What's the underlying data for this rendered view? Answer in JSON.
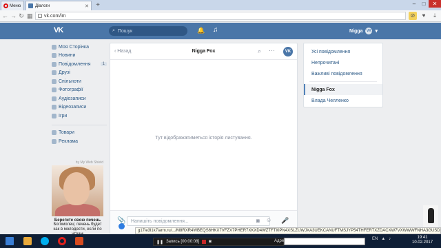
{
  "browser": {
    "menu_label": "Меню",
    "tab_title": "Діалоги",
    "url": "vk.com/im"
  },
  "vk_header": {
    "logo": "VK",
    "search_placeholder": "Пошук",
    "user_name": "Nigga",
    "avatar_text": "VK"
  },
  "left_nav": {
    "items": [
      {
        "label": "Моя Сторінка"
      },
      {
        "label": "Новини"
      },
      {
        "label": "Повідомлення",
        "badge": "1"
      },
      {
        "label": "Друзі"
      },
      {
        "label": "Спільноти"
      },
      {
        "label": "Фотографії"
      },
      {
        "label": "Аудіозаписи"
      },
      {
        "label": "Відеозаписи"
      },
      {
        "label": "Ігри"
      }
    ],
    "extra": [
      {
        "label": "Товари"
      },
      {
        "label": "Реклама"
      }
    ]
  },
  "ad": {
    "header": "by My Web Shield",
    "title": "Берегите свою печень",
    "text": "Богомолец: печень будет как в молодости, если по утрам"
  },
  "chat": {
    "back_label": "Назад",
    "title": "Nigga Fox",
    "avatar_text": "VK",
    "empty_text": "Тут відображатиметься історія листування.",
    "composer_placeholder": "Напишіть повідомлення..."
  },
  "right_panel": {
    "filters": [
      {
        "label": "Усі повідомлення"
      },
      {
        "label": "Непрочитані"
      },
      {
        "label": "Важливі повідомлення"
      }
    ],
    "dialogs": [
      {
        "label": "Nigga Fox",
        "selected": true
      },
      {
        "label": "Влада Челленко",
        "selected": false
      }
    ]
  },
  "status_url": "g17ie3l1k7iarm.ru/.../M8RXR4WBEQS6HKX7VFZX7PHER7XKXD4WZTFTI0PN4XSLZUWJXA3UEKCANUFTMSJYP54THFERTXZDACXW7VXWWWFNHA3GUSD6U",
  "taskbar": {
    "record_label": "Запись [00:00:08]",
    "address_label": "Адрес",
    "lang": "EN",
    "time": "19:41",
    "date": "10.02.2017"
  }
}
